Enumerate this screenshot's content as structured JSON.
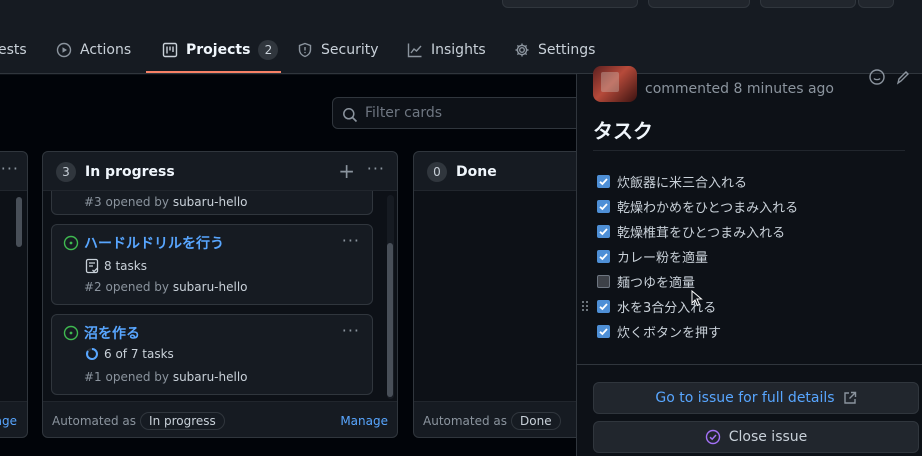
{
  "tabs": [
    {
      "label": "ests",
      "icon": "pull-request-icon"
    },
    {
      "label": "Actions",
      "icon": "play-icon"
    },
    {
      "label": "Projects",
      "icon": "project-icon",
      "count": "2",
      "selected": true
    },
    {
      "label": "Security",
      "icon": "shield-icon"
    },
    {
      "label": "Insights",
      "icon": "graph-icon"
    },
    {
      "label": "Settings",
      "icon": "gear-icon"
    }
  ],
  "filter": {
    "placeholder": "Filter cards"
  },
  "columns": {
    "left": {
      "manage": "age"
    },
    "progress": {
      "count": "3",
      "title": "In progress",
      "cards": [
        {
          "opened": "#3 opened by ",
          "user": "subaru-hello"
        },
        {
          "title": "ハードルドリルを行う",
          "meta": "8 tasks",
          "opened": "#2 opened by ",
          "user": "subaru-hello"
        },
        {
          "title": "沼を作る",
          "meta": "6 of 7 tasks",
          "opened": "#1 opened by ",
          "user": "subaru-hello"
        }
      ],
      "automated": "Automated as",
      "automated_value": "In progress",
      "manage": "Manage"
    },
    "done": {
      "count": "0",
      "title": "Done",
      "automated": "Automated as",
      "automated_value": "Done"
    }
  },
  "panel": {
    "commented": "commented 8 minutes ago",
    "heading": "タスク",
    "tasks": [
      {
        "label": "炊飯器に米三合入れる",
        "checked": true
      },
      {
        "label": "乾燥わかめをひとつまみ入れる",
        "checked": true
      },
      {
        "label": "乾燥椎茸をひとつまみ入れる",
        "checked": true
      },
      {
        "label": "カレー粉を適量",
        "checked": true
      },
      {
        "label": "麺つゆを適量",
        "checked": false
      },
      {
        "label": "水を3合分入れる",
        "checked": true
      },
      {
        "label": "炊くボタンを押す",
        "checked": true
      }
    ],
    "full_details": "Go to issue for full details",
    "close_issue": "Close issue"
  },
  "colors": {
    "accent": "#58a6ff",
    "tab_underline": "#f78166",
    "checkbox": "#4e8fd6",
    "open_issue": "#3fb950",
    "close_icon": "#a371f7"
  }
}
